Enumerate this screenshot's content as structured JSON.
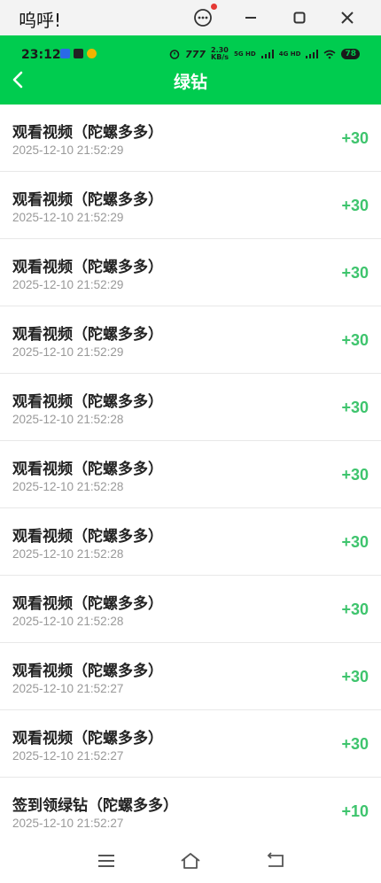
{
  "window": {
    "title": "呜呼!"
  },
  "status_bar": {
    "time": "23:12",
    "speed": "2.30",
    "speed_unit": "KB/s",
    "net1": "5G HD",
    "net2": "4G HD",
    "battery": "78"
  },
  "header": {
    "title": "绿钻"
  },
  "records": [
    {
      "title": "观看视频（陀螺多多）",
      "time": "2025-12-10 21:52:29",
      "amount": "+30"
    },
    {
      "title": "观看视频（陀螺多多）",
      "time": "2025-12-10 21:52:29",
      "amount": "+30"
    },
    {
      "title": "观看视频（陀螺多多）",
      "time": "2025-12-10 21:52:29",
      "amount": "+30"
    },
    {
      "title": "观看视频（陀螺多多）",
      "time": "2025-12-10 21:52:29",
      "amount": "+30"
    },
    {
      "title": "观看视频（陀螺多多）",
      "time": "2025-12-10 21:52:28",
      "amount": "+30"
    },
    {
      "title": "观看视频（陀螺多多）",
      "time": "2025-12-10 21:52:28",
      "amount": "+30"
    },
    {
      "title": "观看视频（陀螺多多）",
      "time": "2025-12-10 21:52:28",
      "amount": "+30"
    },
    {
      "title": "观看视频（陀螺多多）",
      "time": "2025-12-10 21:52:28",
      "amount": "+30"
    },
    {
      "title": "观看视频（陀螺多多）",
      "time": "2025-12-10 21:52:27",
      "amount": "+30"
    },
    {
      "title": "观看视频（陀螺多多）",
      "time": "2025-12-10 21:52:27",
      "amount": "+30"
    },
    {
      "title": "签到领绿钻（陀螺多多）",
      "time": "2025-12-10 21:52:27",
      "amount": "+10"
    }
  ],
  "colors": {
    "header_bg": "#00cc4f",
    "amount": "#3ec46d"
  }
}
